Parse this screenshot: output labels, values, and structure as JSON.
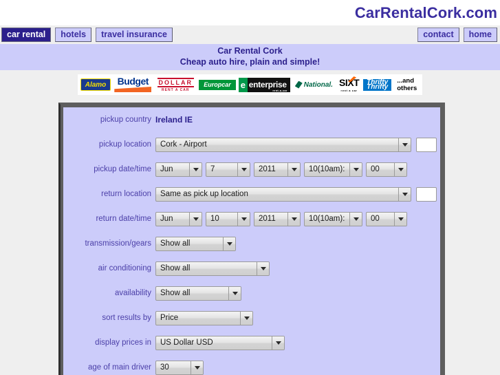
{
  "site": {
    "title": "CarRentalCork.com"
  },
  "nav": {
    "left": [
      {
        "label": "car rental",
        "active": true
      },
      {
        "label": "hotels",
        "active": false
      },
      {
        "label": "travel insurance",
        "active": false
      }
    ],
    "right": [
      {
        "label": "contact"
      },
      {
        "label": "home"
      }
    ]
  },
  "tagline": {
    "line1": "Car Rental Cork",
    "line2": "Cheap auto hire, plain and simple!"
  },
  "brands": [
    {
      "name": "Alamo",
      "label": "Alamo"
    },
    {
      "name": "Budget",
      "label": "Budget"
    },
    {
      "name": "Dollar",
      "label": "DOLLAR",
      "sub": "RENT A CAR"
    },
    {
      "name": "Europcar",
      "label": "Europcar"
    },
    {
      "name": "Enterprise",
      "label": "enterprise",
      "sub": "rent-a-car"
    },
    {
      "name": "National",
      "label": "National."
    },
    {
      "name": "Sixt",
      "label": "SIXT",
      "sub": "rent a car"
    },
    {
      "name": "Thrifty",
      "label": "Thrifty"
    },
    {
      "name": "others",
      "label1": "...and",
      "label2": "others"
    }
  ],
  "form": {
    "pickup_country": {
      "label": "pickup country",
      "value": "Ireland IE"
    },
    "pickup_location": {
      "label": "pickup location",
      "value": "Cork - Airport",
      "extra_value": ""
    },
    "pickup_datetime": {
      "label": "pickup date/time",
      "month": "Jun",
      "day": "7",
      "year": "2011",
      "hour": "10(10am):",
      "minute": "00"
    },
    "return_location": {
      "label": "return location",
      "value": "Same as pick up location",
      "extra_value": ""
    },
    "return_datetime": {
      "label": "return date/time",
      "month": "Jun",
      "day": "10",
      "year": "2011",
      "hour": "10(10am):",
      "minute": "00"
    },
    "transmission": {
      "label": "transmission/gears",
      "value": "Show all"
    },
    "air_conditioning": {
      "label": "air conditioning",
      "value": "Show all"
    },
    "availability": {
      "label": "availability",
      "value": "Show all"
    },
    "sort_results": {
      "label": "sort results by",
      "value": "Price"
    },
    "display_prices": {
      "label": "display prices in",
      "value": "US Dollar USD"
    },
    "driver_age": {
      "label": "age of main driver",
      "value": "30"
    }
  },
  "colors": {
    "brand_purple": "#3b2ea0",
    "panel_lavender": "#ccccfa",
    "active_tab": "#2b1f8c",
    "page_bg": "#efefef"
  }
}
